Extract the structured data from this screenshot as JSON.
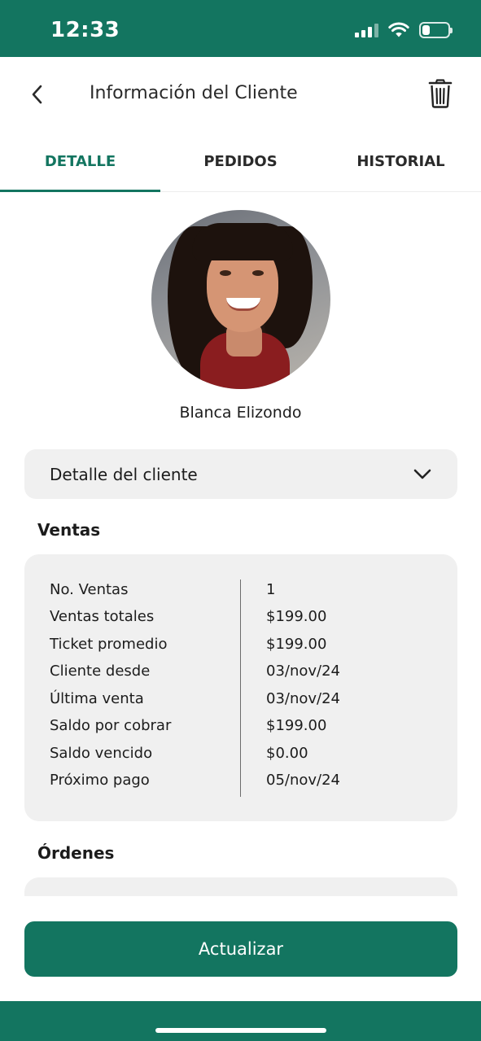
{
  "status_bar": {
    "time": "12:33",
    "battery_level": 0.3
  },
  "header": {
    "title": "Información del Cliente",
    "back_icon": "chevron-left-icon",
    "delete_icon": "trash-icon"
  },
  "tabs": [
    {
      "label": "DETALLE",
      "active": true
    },
    {
      "label": "PEDIDOS",
      "active": false
    },
    {
      "label": "HISTORIAL",
      "active": false
    }
  ],
  "client": {
    "name": "Blanca Elizondo"
  },
  "accordion": {
    "label": "Detalle del cliente",
    "icon": "chevron-down-icon"
  },
  "sales": {
    "title": "Ventas",
    "rows": [
      {
        "label": "No. Ventas",
        "value": "1"
      },
      {
        "label": "Ventas totales",
        "value": "$199.00"
      },
      {
        "label": "Ticket promedio",
        "value": "$199.00"
      },
      {
        "label": "Cliente desde",
        "value": "03/nov/24"
      },
      {
        "label": "Última venta",
        "value": "03/nov/24"
      },
      {
        "label": "Saldo por cobrar",
        "value": "$199.00"
      },
      {
        "label": "Saldo vencido",
        "value": "$0.00"
      },
      {
        "label": "Próximo pago",
        "value": "05/nov/24"
      }
    ]
  },
  "orders": {
    "title": "Órdenes"
  },
  "actions": {
    "update_label": "Actualizar"
  },
  "colors": {
    "primary": "#137560",
    "card": "#f0f0f0"
  }
}
